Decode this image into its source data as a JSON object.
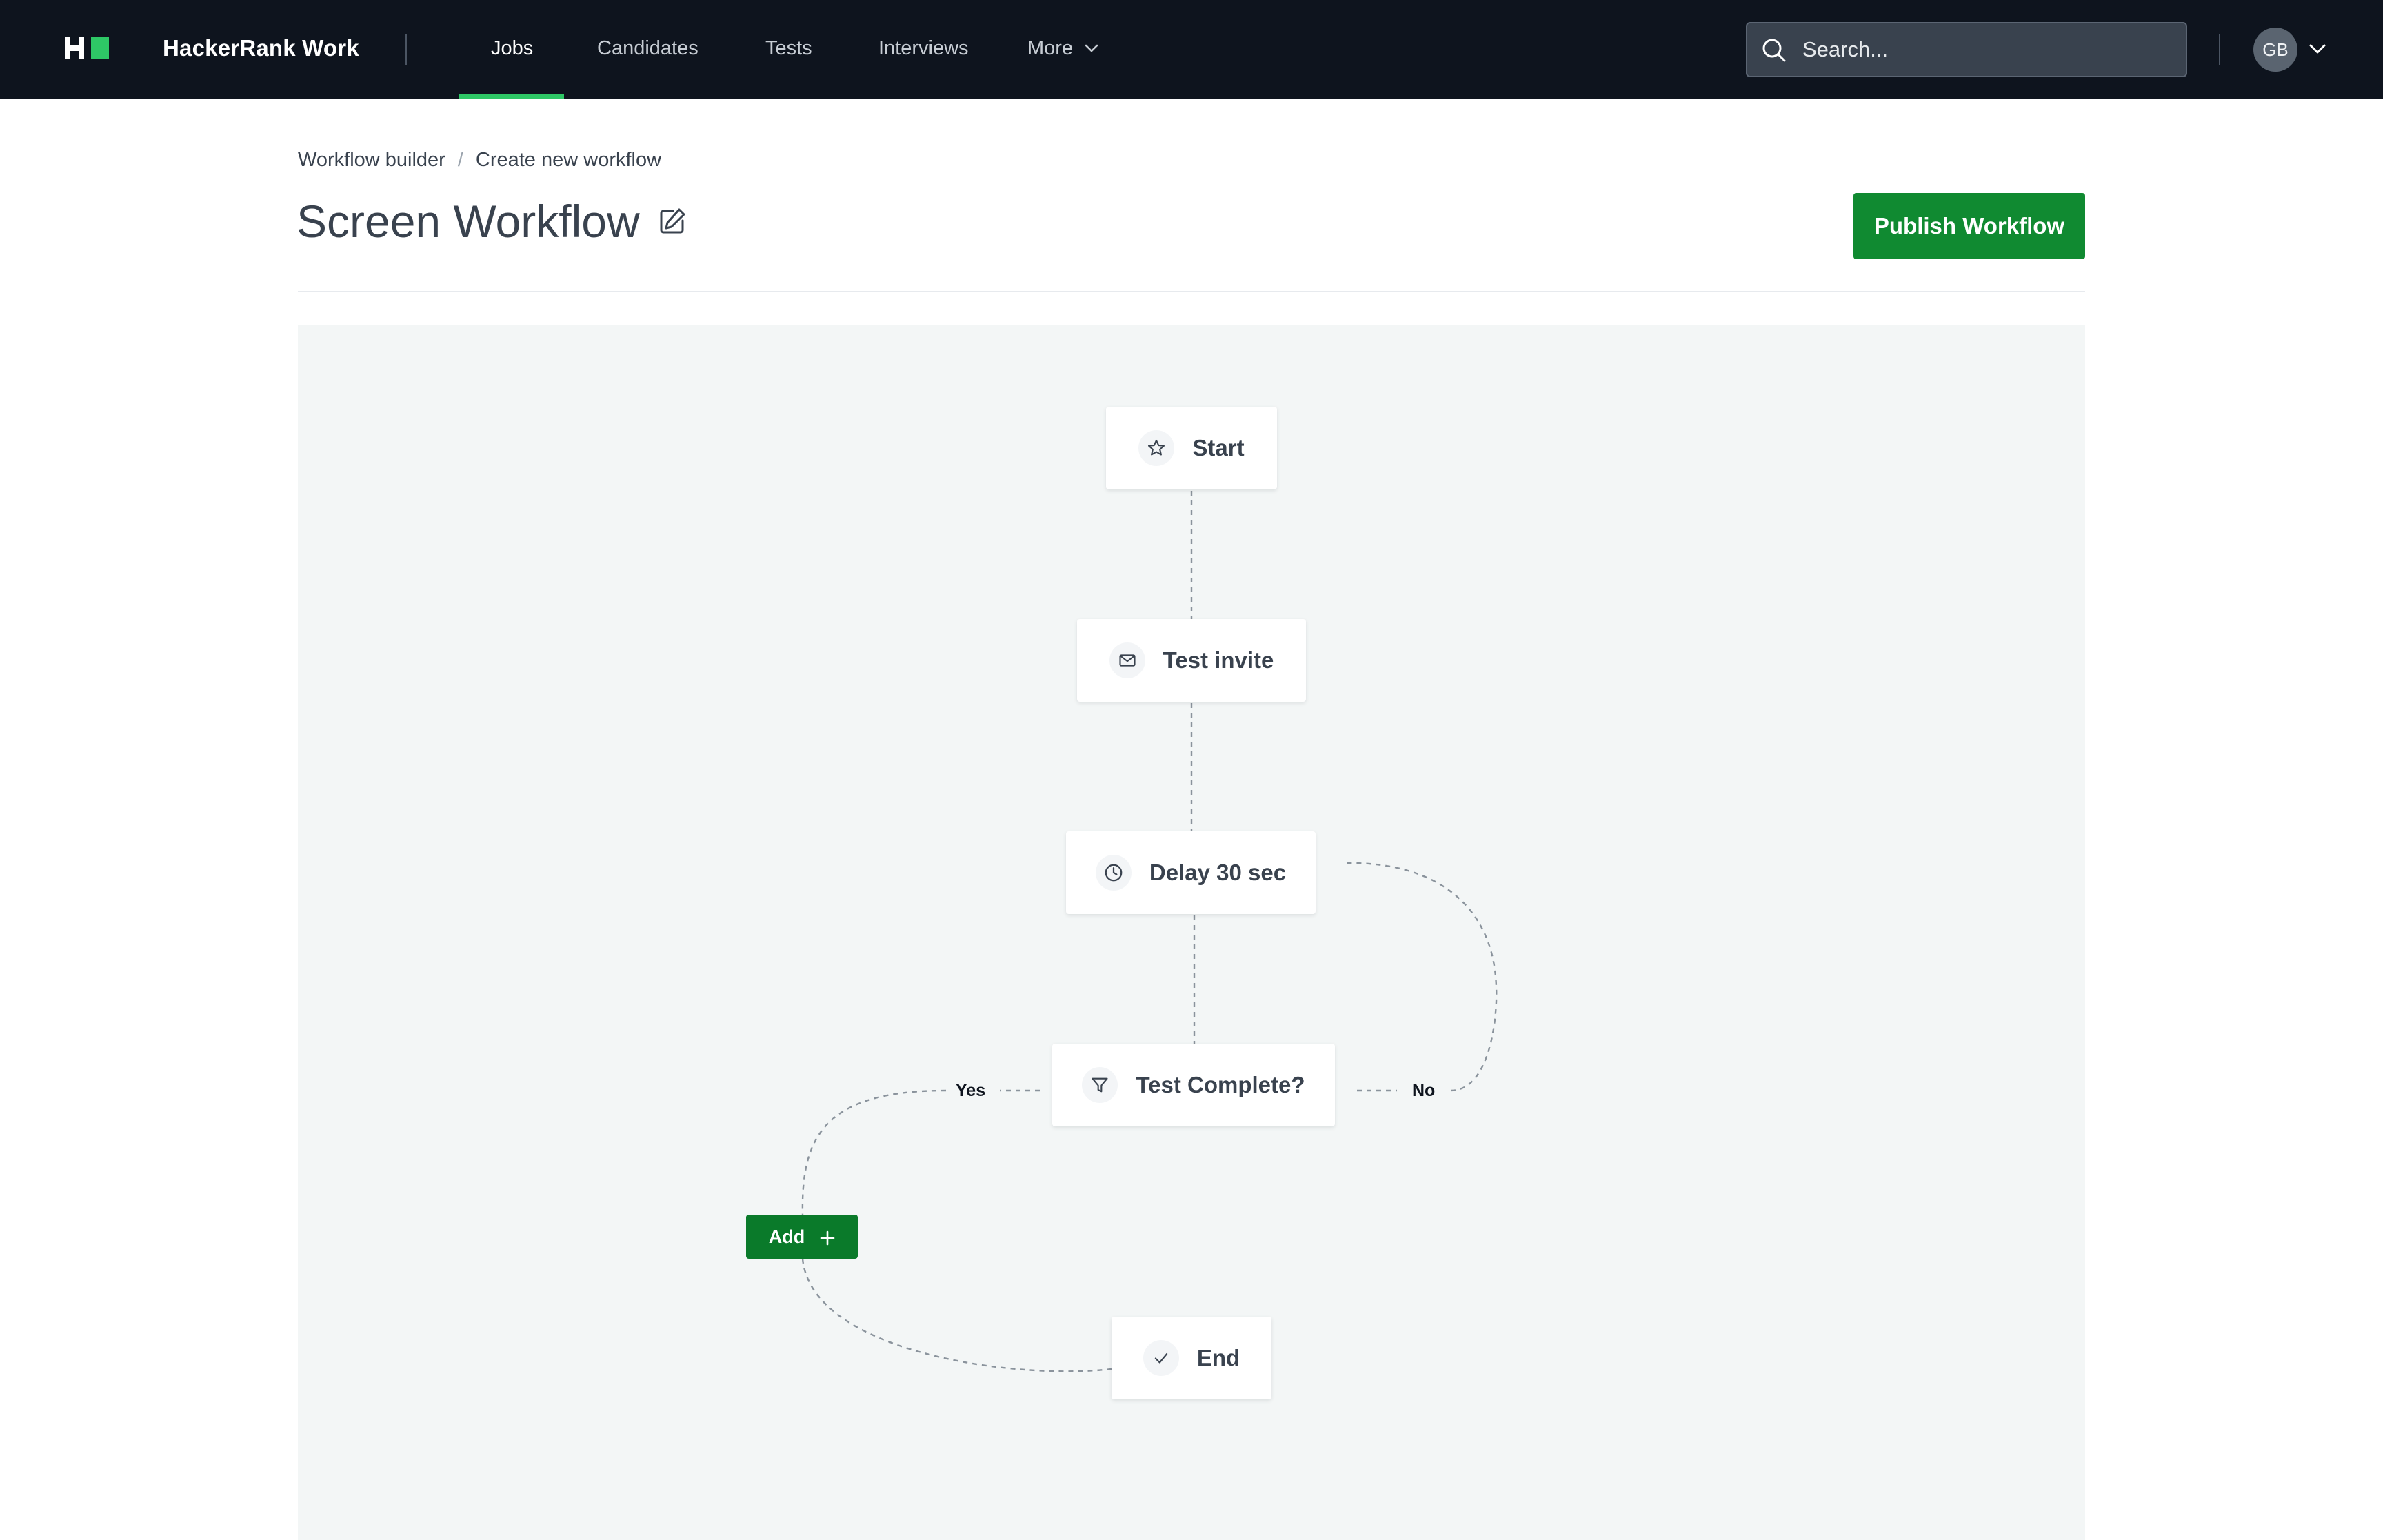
{
  "app": {
    "brand": "HackerRank Work",
    "logo_icon": "hackerrank-logo",
    "accent_color": "#2ec866",
    "primary_button_color": "#108a31"
  },
  "nav": {
    "items": [
      {
        "label": "Jobs",
        "active": true
      },
      {
        "label": "Candidates",
        "active": false
      },
      {
        "label": "Tests",
        "active": false
      },
      {
        "label": "Interviews",
        "active": false
      },
      {
        "label": "More",
        "active": false
      }
    ],
    "more_icon": "chevron-down-icon"
  },
  "search": {
    "placeholder": "Search...",
    "value": "",
    "icon": "search-icon"
  },
  "user": {
    "initials": "GB",
    "menu_icon": "chevron-down-icon"
  },
  "breadcrumb": {
    "items": [
      "Workflow builder",
      "Create new workflow"
    ],
    "separator": "/"
  },
  "page": {
    "title": "Screen Workflow",
    "edit_icon": "edit-icon",
    "publish_label": "Publish Workflow"
  },
  "workflow": {
    "nodes": [
      {
        "id": "start",
        "label": "Start",
        "icon": "star-icon"
      },
      {
        "id": "test-invite",
        "label": "Test invite",
        "icon": "mail-icon"
      },
      {
        "id": "delay",
        "label": "Delay 30 sec",
        "icon": "clock-icon"
      },
      {
        "id": "condition",
        "label": "Test Complete?",
        "icon": "filter-icon"
      },
      {
        "id": "end",
        "label": "End",
        "icon": "check-icon"
      }
    ],
    "branches": {
      "yes": "Yes",
      "no": "No"
    },
    "add_label": "Add",
    "add_icon": "plus-icon"
  }
}
